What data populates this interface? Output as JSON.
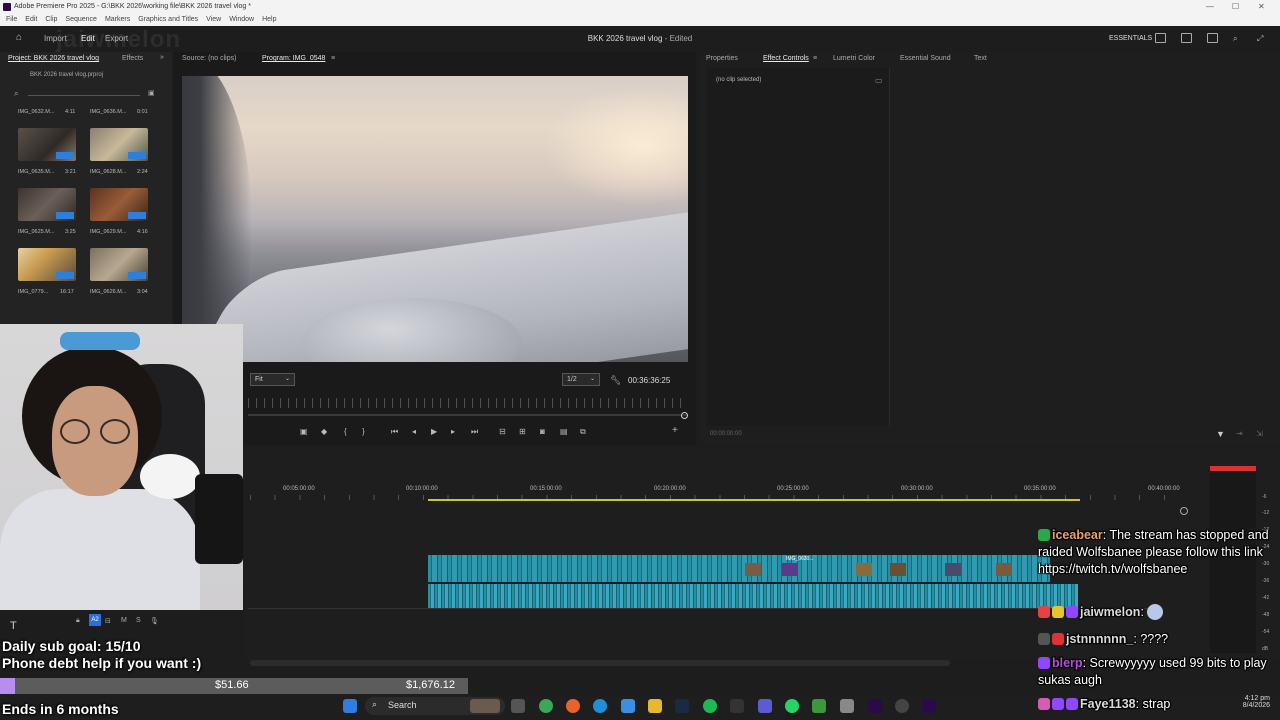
{
  "window": {
    "title": "Adobe Premiere Pro 2025 - G:\\BKK 2026\\working file\\BKK 2026 travel vlog *"
  },
  "menu": [
    "File",
    "Edit",
    "Clip",
    "Sequence",
    "Markers",
    "Graphics and Titles",
    "View",
    "Window",
    "Help"
  ],
  "header": {
    "nav": [
      "Import",
      "Edit",
      "Export"
    ],
    "watermark": "jaiwmelon",
    "center_title": "BKK 2026 travel vlog",
    "center_status": "- Edited",
    "workspace": "ESSENTIALS"
  },
  "project": {
    "tabs": [
      "Project: BKK 2026 travel vlog",
      "Effects"
    ],
    "file": "BKK 2026 travel vlog.prproj",
    "clips": [
      {
        "name": "IMG_0632.M...",
        "dur": "4:11"
      },
      {
        "name": "IMG_0636.M...",
        "dur": "0:01"
      },
      {
        "name": "IMG_0635.M...",
        "dur": "3:21"
      },
      {
        "name": "IMG_0628.M...",
        "dur": "2:24"
      },
      {
        "name": "IMG_0625.M...",
        "dur": "3:25"
      },
      {
        "name": "IMG_0629.M...",
        "dur": "4:16"
      },
      {
        "name": "IMG_0779...",
        "dur": "16:17"
      },
      {
        "name": "IMG_0626.M...",
        "dur": "3:04"
      }
    ]
  },
  "monitor": {
    "source_tab": "Source: (no clips)",
    "program_tab": "Program: IMG_0548",
    "fit": "Fit",
    "resolution": "1/2",
    "timecode": "00:36:36:25"
  },
  "effects": {
    "tabs": [
      "Properties",
      "Effect Controls",
      "Lumetri Color",
      "Essential Sound",
      "Text"
    ],
    "no_clip": "(no clip selected)",
    "timecode": "00:00:00:00"
  },
  "timeline": {
    "ruler": [
      "00:05:00:00",
      "00:10:00:00",
      "00:15:00:00",
      "00:20:00:00",
      "00:25:00:00",
      "00:30:00:00",
      "00:35:00:00",
      "00:40:00:00"
    ],
    "clip_label": "IMG_0630..."
  },
  "meters": {
    "db": [
      "-6",
      "-12",
      "-18",
      "-24",
      "-30",
      "-36",
      "-42",
      "-48",
      "-54",
      "dB"
    ]
  },
  "overlay": {
    "goal": "Daily sub goal: 15/10",
    "debt": "Phone debt help if you want :)",
    "progress_current": "$51.66",
    "progress_goal": "$1,676.12",
    "progress_fraction": 0.031,
    "ends": "Ends in 6 months"
  },
  "chat": [
    {
      "user": "iceabear",
      "color": "#e8a069",
      "badge_color": "#2aa84a",
      "message": "The stream has stopped and raided Wolfsbanee please follow this link https://twitch.tv/wolfsbanee"
    },
    {
      "user": "jaiwmelon",
      "color": "#d9d9d9",
      "badge_color": "#e84141",
      "message": ""
    },
    {
      "user": "jstnnnnnn_",
      "color": "#d9d9d9",
      "badge_color": "#555555",
      "message": "????"
    },
    {
      "user": "blerp",
      "color": "#b44fd8",
      "badge_color": "#9147ff",
      "message": "Screwyyyyy used 99 bits to play sukas augh"
    },
    {
      "user": "Faye1138",
      "color": "#d9d9d9",
      "badge_color": "#d65cb5",
      "message": "strap"
    }
  ],
  "taskbar": {
    "search": "Search",
    "time": "4:12 pm",
    "date": "8/4/2026"
  }
}
